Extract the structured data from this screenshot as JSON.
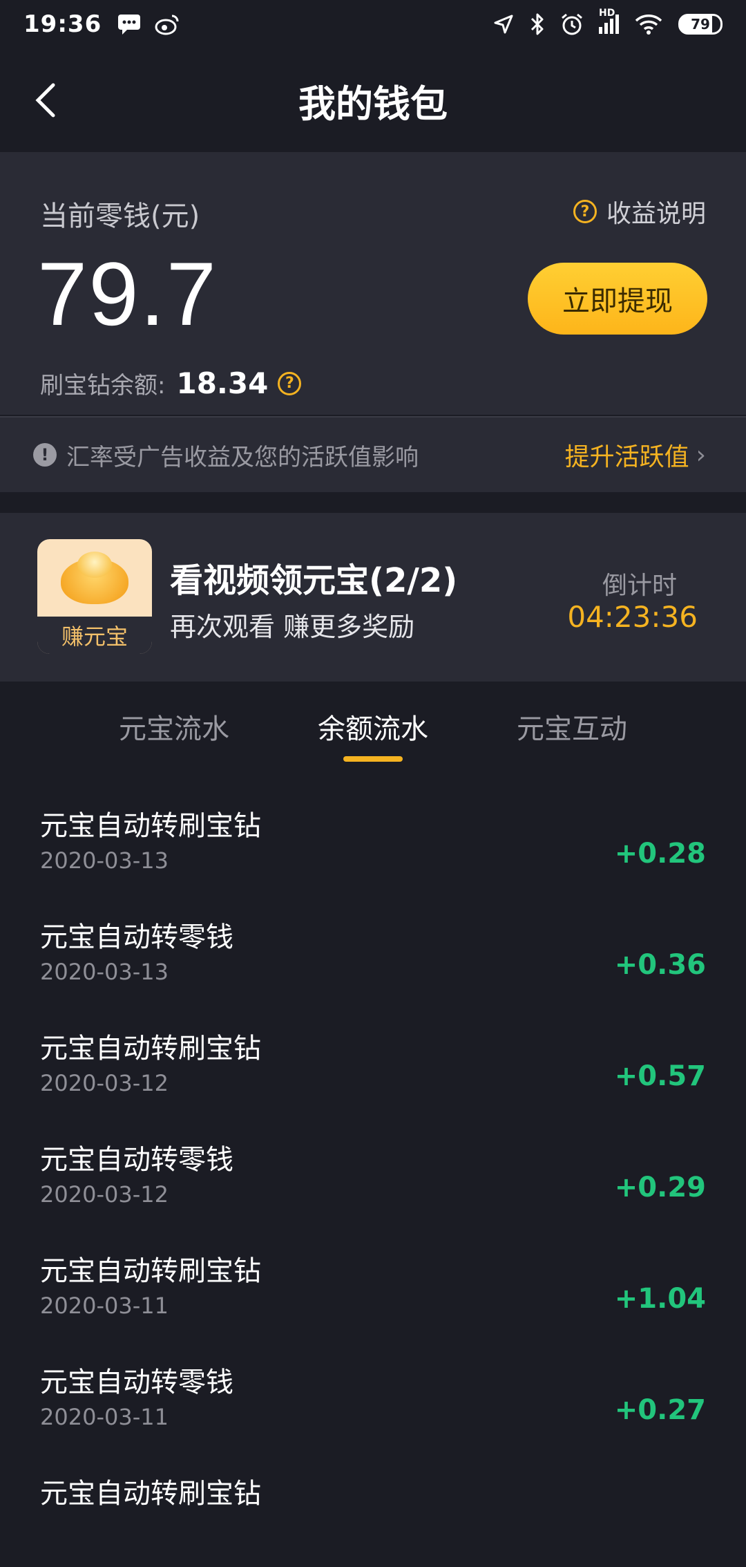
{
  "status_bar": {
    "time": "19:36",
    "battery": "79",
    "icons": [
      "message-icon",
      "weibo-icon",
      "location-icon",
      "bluetooth-icon",
      "alarm-icon",
      "signal-icon",
      "wifi-icon",
      "battery-icon"
    ],
    "network_label": "HD"
  },
  "nav": {
    "title": "我的钱包"
  },
  "wallet": {
    "balance_label": "当前零钱(元)",
    "help_label": "收益说明",
    "balance": "79.7",
    "withdraw_label": "立即提现",
    "diamond_label": "刷宝钻余额:",
    "diamond_value": "18.34"
  },
  "notice": {
    "text": "汇率受广告收益及您的活跃值影响",
    "link": "提升活跃值"
  },
  "task": {
    "icon_label": "赚元宝",
    "title": "看视频领元宝(2/2)",
    "subtitle": "再次观看 赚更多奖励",
    "countdown_label": "倒计时",
    "countdown": "04:23:36"
  },
  "tabs": [
    {
      "label": "元宝流水"
    },
    {
      "label": "余额流水"
    },
    {
      "label": "元宝互动"
    }
  ],
  "active_tab": 1,
  "records": [
    {
      "title": "元宝自动转刷宝钻",
      "date": "2020-03-13",
      "amount": "+0.28"
    },
    {
      "title": "元宝自动转零钱",
      "date": "2020-03-13",
      "amount": "+0.36"
    },
    {
      "title": "元宝自动转刷宝钻",
      "date": "2020-03-12",
      "amount": "+0.57"
    },
    {
      "title": "元宝自动转零钱",
      "date": "2020-03-12",
      "amount": "+0.29"
    },
    {
      "title": "元宝自动转刷宝钻",
      "date": "2020-03-11",
      "amount": "+1.04"
    },
    {
      "title": "元宝自动转零钱",
      "date": "2020-03-11",
      "amount": "+0.27"
    },
    {
      "title": "元宝自动转刷宝钻",
      "date": "",
      "amount": ""
    }
  ],
  "colors": {
    "background": "#1b1c24",
    "card": "#2a2b35",
    "accent": "#f5b321",
    "positive": "#22c57c"
  }
}
